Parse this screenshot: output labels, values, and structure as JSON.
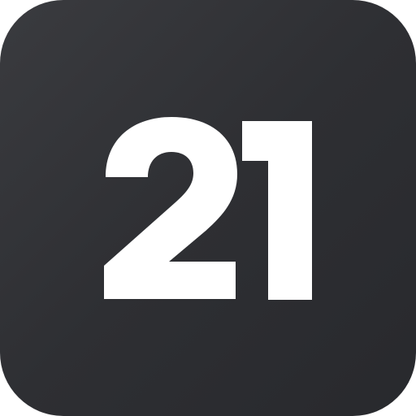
{
  "icon": {
    "number": "21",
    "colors": {
      "background": "#2f3034",
      "foreground": "#ffffff"
    }
  }
}
